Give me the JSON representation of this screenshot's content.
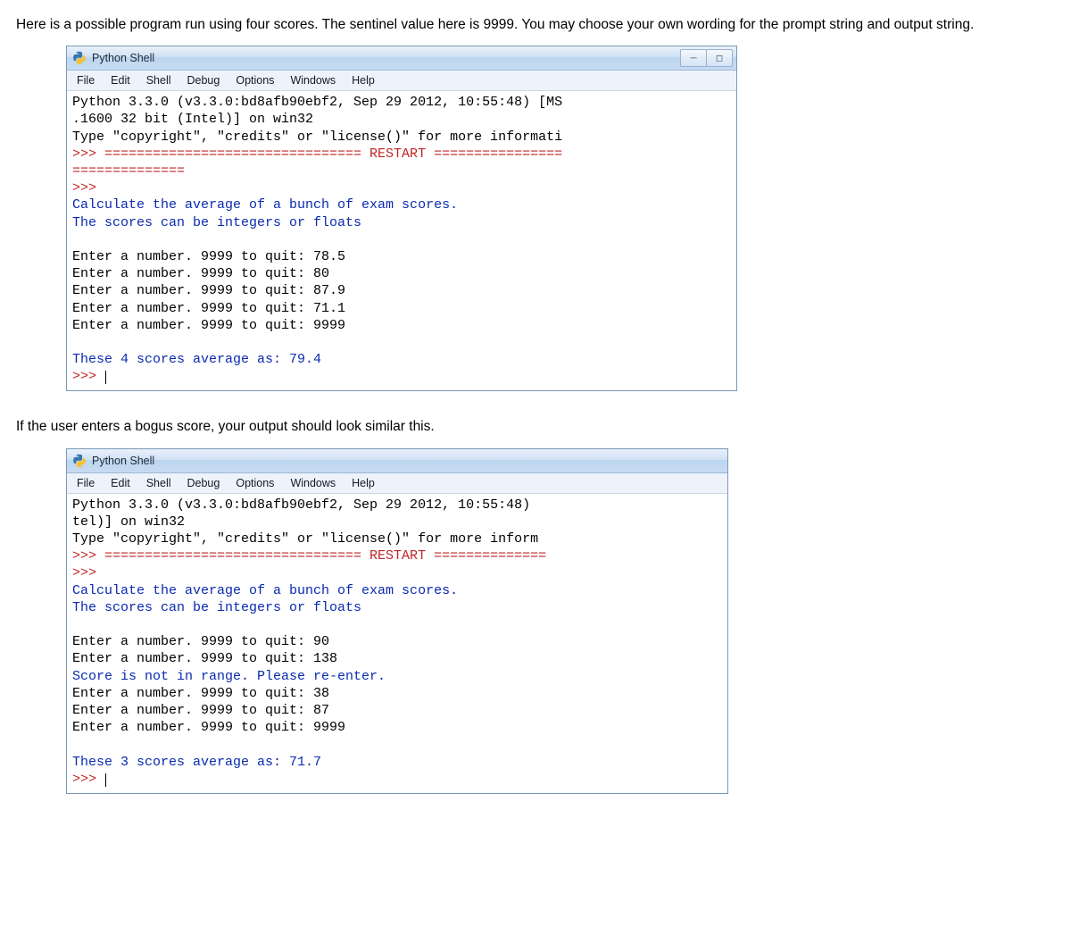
{
  "intro_text": "Here is a possible program run using four scores. The sentinel value here is 9999. You may choose your own wording for the prompt string and output string.",
  "mid_text": "If the user enters a bogus score, your output should look similar this.",
  "window": {
    "title": "Python Shell",
    "minimize_glyph": "─",
    "maximize_glyph": "◻",
    "menus": [
      "File",
      "Edit",
      "Shell",
      "Debug",
      "Options",
      "Windows",
      "Help"
    ]
  },
  "console1": {
    "banner_l1": "Python 3.3.0 (v3.3.0:bd8afb90ebf2, Sep 29 2012, 10:55:48) [MS",
    "banner_l2": ".1600 32 bit (Intel)] on win32",
    "banner_l3": "Type \"copyright\", \"credits\" or \"license()\" for more informati",
    "restart_line": ">>> ================================ RESTART ================",
    "restart_tail": "==============",
    "prompt": ">>> ",
    "out_l1": "Calculate the average of a bunch of exam scores.",
    "out_l2": "The scores can be integers or floats",
    "in_l1": "Enter a number. 9999 to quit: 78.5",
    "in_l2": "Enter a number. 9999 to quit: 80",
    "in_l3": "Enter a number. 9999 to quit: 87.9",
    "in_l4": "Enter a number. 9999 to quit: 71.1",
    "in_l5": "Enter a number. 9999 to quit: 9999",
    "result": "These 4 scores average as: 79.4"
  },
  "console2": {
    "banner_l1": "Python 3.3.0 (v3.3.0:bd8afb90ebf2, Sep 29 2012, 10:55:48)",
    "banner_l2": "tel)] on win32",
    "banner_l3": "Type \"copyright\", \"credits\" or \"license()\" for more inform",
    "restart_line": ">>> ================================ RESTART ==============",
    "prompt": ">>> ",
    "out_l1": "Calculate the average of a bunch of exam scores.",
    "out_l2": "The scores can be integers or floats",
    "in_l1": "Enter a number. 9999 to quit: 90",
    "in_l2": "Enter a number. 9999 to quit: 138",
    "err_l1": "Score is not in range. Please re-enter.",
    "in_l3": "Enter a number. 9999 to quit: 38",
    "in_l4": "Enter a number. 9999 to quit: 87",
    "in_l5": "Enter a number. 9999 to quit: 9999",
    "result": "These 3 scores average as: 71.7"
  }
}
